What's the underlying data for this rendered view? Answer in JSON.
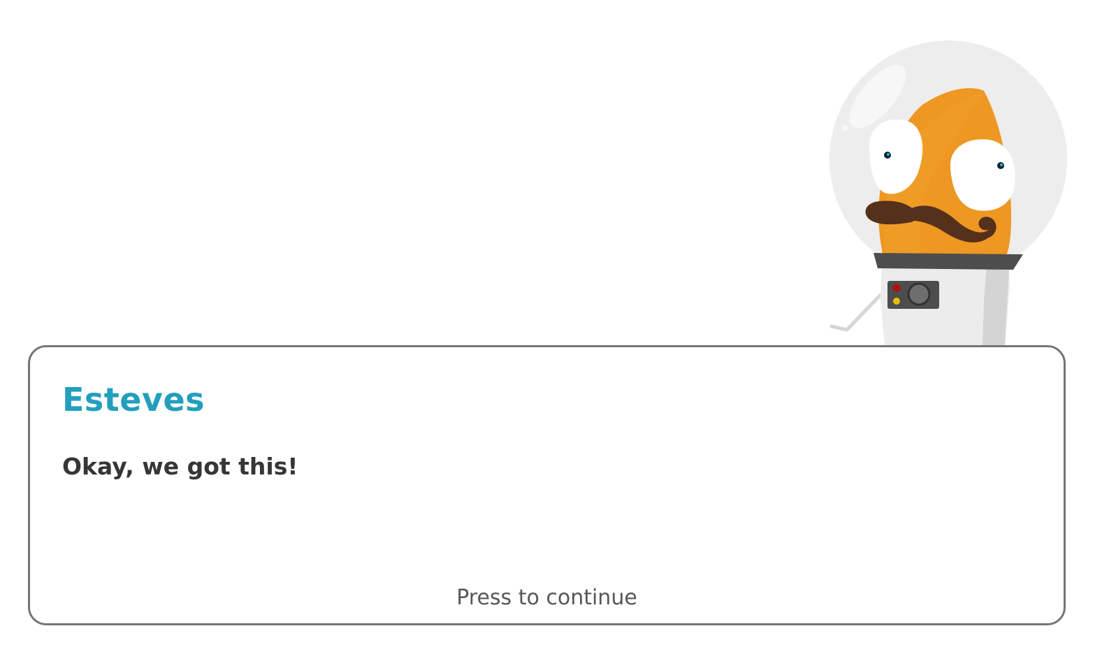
{
  "dialog": {
    "speaker": "Esteves",
    "text": "Okay, we got this!",
    "continue_label": "Press to continue"
  },
  "character": {
    "icon": "astronaut-mascot-icon"
  },
  "colors": {
    "speaker": "#229fbd",
    "text": "#363636",
    "continue": "#575757",
    "border": "#757575",
    "helmet": "#ededed",
    "body_orange": "#ee9722",
    "mustache": "#55301a",
    "collar": "#4d4d4d"
  }
}
